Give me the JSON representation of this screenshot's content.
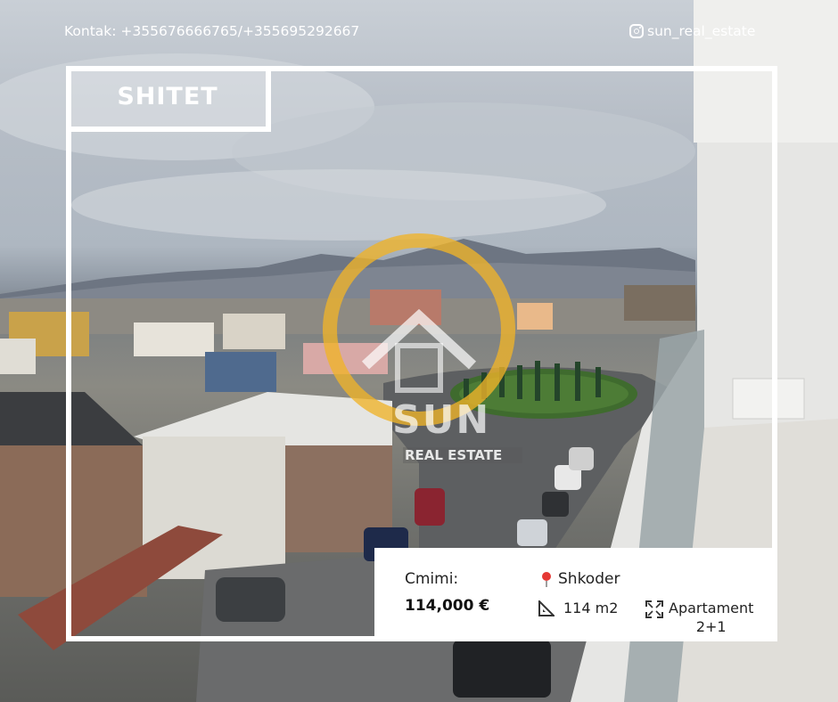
{
  "header": {
    "contact": "Kontak: +355676666765/+355695292667",
    "instagram_handle": "sun_real_estate",
    "instagram_icon": "instagram-icon"
  },
  "tag": {
    "label": "SHITET"
  },
  "watermark": {
    "brand": "SUN",
    "subtitle": "REAL ESTATE",
    "accent": "#f0b429"
  },
  "info": {
    "price_label": "Cmimi:",
    "price_value": "114,000 €",
    "location": "Shkoder",
    "location_icon": "map-pin-icon",
    "area": "114 m2",
    "area_icon": "ruler-triangle-icon",
    "type_line1": "Apartament",
    "type_line2": "2+1",
    "type_icon": "expand-icon"
  },
  "colors": {
    "frame": "#ffffff",
    "pin": "#e53935",
    "text": "#222222"
  }
}
